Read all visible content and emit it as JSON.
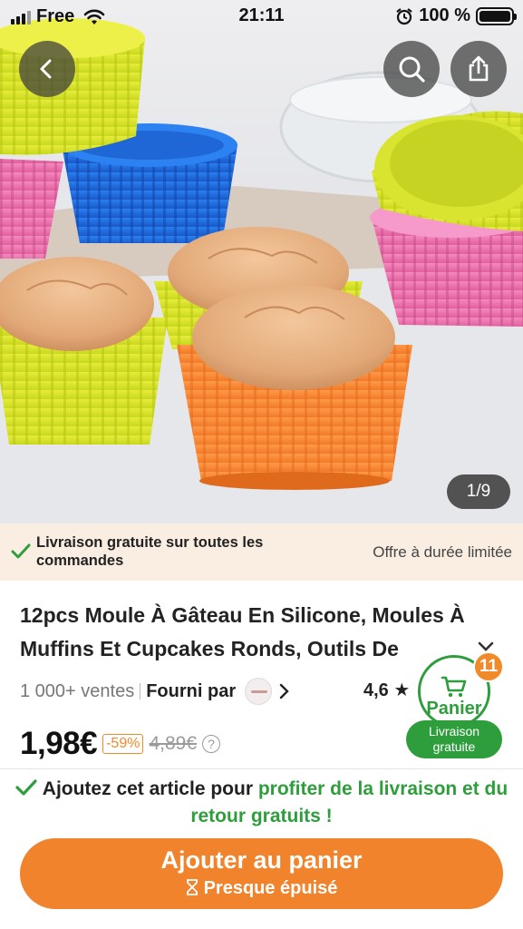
{
  "status_bar": {
    "carrier": "Free",
    "time": "21:11",
    "battery_percent": "100 %",
    "battery_level": 1.0,
    "signal_bars": 3
  },
  "gallery": {
    "counter": "1/9",
    "current_index": 1,
    "total_images": 9
  },
  "promo": {
    "text": "Livraison gratuite sur toutes les commandes",
    "right_text": "Offre à durée limitée"
  },
  "product": {
    "title": "12pcs Moule À Gâteau En Silicone, Moules À Muffins Et Cupcakes Ronds, Outils De",
    "sales": "1 000+ ventes",
    "supplied_by": "Fourni par",
    "rating": "4,6 ★",
    "price": "1,98€",
    "discount": "-59%",
    "old_price": "4,89€",
    "help_icon_label": "?"
  },
  "cart_widget": {
    "count": "11",
    "label": "Panier",
    "ribbon": "Livraison gratuite"
  },
  "free_shipping_message": {
    "prefix": "Ajoutez cet article pour ",
    "highlight": "profiter de la livraison et du retour gratuits !"
  },
  "cta": {
    "label": "Ajouter au panier",
    "sublabel": "Presque épuisé"
  },
  "colors": {
    "accent_orange": "#f0832b",
    "accent_green": "#2e9e3d",
    "promo_background": "#faeee3"
  },
  "icons": {
    "back": "chevron-left-icon",
    "search": "search-icon",
    "share": "share-icon",
    "check": "check-icon",
    "cart": "cart-icon",
    "hourglass": "hourglass-icon"
  }
}
